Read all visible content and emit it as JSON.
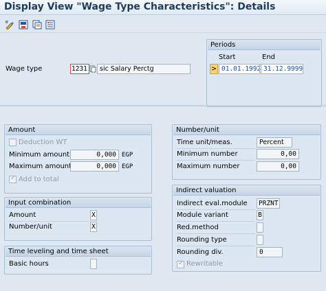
{
  "window": {
    "title": "Display View \"Wage Type Characteristics\": Details"
  },
  "toolbar": {
    "icons": [
      "display-change-icon",
      "save-icon",
      "copy-icon",
      "details-icon"
    ]
  },
  "header": {
    "wage_type_label": "Wage type",
    "wage_type_code": "1231",
    "wage_type_text": "sic Salary Perctg"
  },
  "periods": {
    "title": "Periods",
    "start_label": "Start",
    "end_label": "End",
    "start": "01.01.1992",
    "end": "31.12.9999",
    "select_glyph": ">"
  },
  "amount": {
    "title": "Amount",
    "deduction_wt": "Deduction WT",
    "min_label": "Minimum amount",
    "min_value": "0,000",
    "min_currency": "EGP",
    "max_label": "Maximum amount",
    "max_value": "0,000",
    "max_currency": "EGP",
    "add_to_total": "Add to total"
  },
  "input_combination": {
    "title": "Input combination",
    "amount_label": "Amount",
    "amount_value": "X",
    "number_label": "Number/unit",
    "number_value": "X"
  },
  "time_leveling": {
    "title": "Time leveling and time sheet",
    "basic_hours_label": "Basic hours",
    "basic_hours_value": ""
  },
  "number_unit": {
    "title": "Number/unit",
    "time_unit_label": "Time unit/meas.",
    "time_unit_value": "Percent",
    "min_label": "Minimum number",
    "min_value": "0,00",
    "max_label": "Maximum number",
    "max_value": "0,00"
  },
  "indirect_valuation": {
    "title": "Indirect valuation",
    "module_label": "Indirect eval.module",
    "module_value": "PRZNT",
    "variant_label": "Module variant",
    "variant_value": "B",
    "red_method_label": "Red.method",
    "red_method_value": "",
    "rounding_type_label": "Rounding type",
    "rounding_type_value": "",
    "rounding_div_label": "Rounding div.",
    "rounding_div_value": "0",
    "rewritable": "Rewritable"
  }
}
